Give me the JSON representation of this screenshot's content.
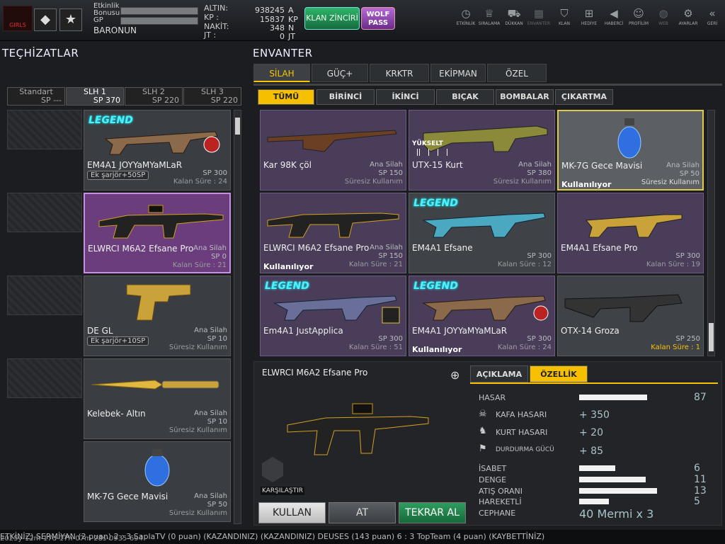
{
  "profile": {
    "logo_text": "GIRLS",
    "event_bonus_label": "Etkinlik Bonusu",
    "gp_label": "GP",
    "username": "BARONUN"
  },
  "currency": [
    {
      "label": "ALTIN:",
      "value": "938245",
      "unit": "A"
    },
    {
      "label": "KP   :",
      "value": "15837",
      "unit": "KP"
    },
    {
      "label": "NAKİT:",
      "value": "348",
      "unit": "N"
    },
    {
      "label": "JT   :",
      "value": "0",
      "unit": "JT"
    }
  ],
  "topbuttons": {
    "klan_chain": "KLAN ZİNCİRİ",
    "wolf_pass": "WOLF PASS"
  },
  "nav": [
    {
      "label": "ETKİNLİK",
      "icon": "clock-icon"
    },
    {
      "label": "SIRALAMA",
      "icon": "rank-icon"
    },
    {
      "label": "DÜKKAN",
      "icon": "cart-icon"
    },
    {
      "label": "ENVANTER",
      "icon": "inventory-icon"
    },
    {
      "label": "KLAN",
      "icon": "shield-icon"
    },
    {
      "label": "HEDİYE",
      "icon": "gift-icon"
    },
    {
      "label": "HABERCİ",
      "icon": "megaphone-icon"
    },
    {
      "label": "PROFİLİM",
      "icon": "user-icon"
    },
    {
      "label": "WEB",
      "icon": "globe-icon"
    },
    {
      "label": "AYARLAR",
      "icon": "gear-icon"
    },
    {
      "label": "GERİ",
      "icon": "back-icon"
    }
  ],
  "equipment": {
    "title": "TEÇHİZATLAR",
    "slot_tabs": [
      {
        "name": "Standart",
        "sp": "SP ---"
      },
      {
        "name": "SLH 1",
        "sp": "SP 370"
      },
      {
        "name": "SLH 2",
        "sp": "SP 220"
      },
      {
        "name": "SLH 3",
        "sp": "SP 220"
      }
    ],
    "cards": [
      {
        "name": "EM4A1 JOYYaMYaMLaR",
        "type": "Ana Silah",
        "extra": "Ek şarjör+50SP",
        "sp": "SP 300",
        "duration": "Kalan Süre : 24",
        "legend": "LEGEND"
      },
      {
        "name": "ELWRCI M6A2 Efsane Pro",
        "type": "Ana Silah",
        "sp": "SP 0",
        "duration": "Kalan Süre : 21"
      },
      {
        "name": "DE GL",
        "type": "Ana Silah",
        "extra": "Ek şarjör+10SP",
        "sp": "SP 10",
        "duration": "Süresiz Kullanım"
      },
      {
        "name": "Kelebek- Altın",
        "type": "Ana Silah",
        "sp": "SP 10",
        "duration": "Süresiz Kullanım"
      },
      {
        "name": "MK-7G Gece Mavisi",
        "type": "Ana Silah",
        "sp": "SP 50",
        "duration": "Süresiz Kullanım"
      }
    ]
  },
  "inventory": {
    "title": "ENVANTER",
    "tabs": [
      "SİLAH",
      "GÜÇ+",
      "KRKTR",
      "EKİPMAN",
      "ÖZEL"
    ],
    "filters": [
      "TÜMÜ",
      "BİRİNCİ",
      "İKİNCİ",
      "BIÇAK",
      "BOMBALAR",
      "ÇIKARTMA"
    ],
    "upgrade_label": "YÜKSELT",
    "items": [
      {
        "name": "Kar 98K çöl",
        "type": "Ana Silah",
        "sp": "SP 150",
        "duration": "Süresiz Kullanım"
      },
      {
        "name": "UTX-15 Kurt",
        "type": "Ana Silah",
        "sp": "SP 380",
        "duration": "Süresiz Kullanım"
      },
      {
        "name": "MK-7G Gece Mavisi",
        "type": "Ana Silah",
        "sp": "SP 50",
        "duration": "Süresiz Kullanım",
        "status": "Kullanılıyor"
      },
      {
        "name": "ELWRCI M6A2 Efsane Pro",
        "type": "Ana Silah",
        "sp": "SP 150",
        "duration": "Kalan Süre : 21",
        "status": "Kullanılıyor"
      },
      {
        "name": "EM4A1 Efsane",
        "sp": "SP 300",
        "duration": "Kalan Süre : 12",
        "legend": "LEGEND"
      },
      {
        "name": "EM4A1 Efsane Pro",
        "sp": "SP 300",
        "duration": "Kalan Süre : 19"
      },
      {
        "name": "Em4A1 JustApplica",
        "sp": "SP 300",
        "duration": "Kalan Süre : 51",
        "legend": "LEGEND"
      },
      {
        "name": "EM4A1 JOYYaMYaMLaR",
        "sp": "SP 300",
        "duration": "Kalan Süre : 24",
        "status": "Kullanılıyor",
        "legend": "LEGEND"
      },
      {
        "name": "OTX-14 Groza",
        "sp": "SP 250",
        "duration": "Kalan Süre : 1"
      }
    ]
  },
  "detail": {
    "name": "ELWRCI M6A2 Efsane Pro",
    "compare_label": "KARŞILAŞTIR",
    "tabs": [
      "AÇIKLAMA",
      "ÖZELLİK"
    ],
    "stats": [
      {
        "label": "HASAR",
        "value": "87",
        "fraction": 0.87
      },
      {
        "label": "KAFA HASARI",
        "value": "+ 350",
        "icon": "skull-icon"
      },
      {
        "label": "KURT HASARI",
        "value": "+ 20",
        "icon": "wolf-icon"
      },
      {
        "label": "DURDURMA GÜCÜ",
        "value": "+ 85",
        "icon": "stop-icon"
      },
      {
        "label": "İSABET",
        "value": "6",
        "fraction": 0.46
      },
      {
        "label": "DENGE",
        "value": "11",
        "fraction": 0.85
      },
      {
        "label": "ATIŞ ORANI",
        "value": "13",
        "fraction": 1.0
      },
      {
        "label": "HAREKETLİ",
        "value": "5",
        "fraction": 0.38
      },
      {
        "label": "CEPHANE",
        "value": "40 Mermi x 3"
      }
    ],
    "buttons": {
      "use": "KULLAN",
      "drop": "AT",
      "renew": "TEKRAR AL"
    }
  },
  "ticker": "ETKİNİZ) SERMİYAN (2 puan) 2 : 3 SaplaTV (0 puan) (KAZANDINIZ)        (KAZANDINIZ) DEUSES (143 puan) 6 : 3 TopTeam (4 puan) (KAYBETTİNİZ)",
  "timestamp": "2025y-12m-17d-17h-07m-28s-0935-694",
  "colors": {
    "accent": "#f6c000",
    "legend": "#4ff0ff",
    "klan_green": "#2fb46c",
    "wolf_purple": "#b66ad6"
  }
}
